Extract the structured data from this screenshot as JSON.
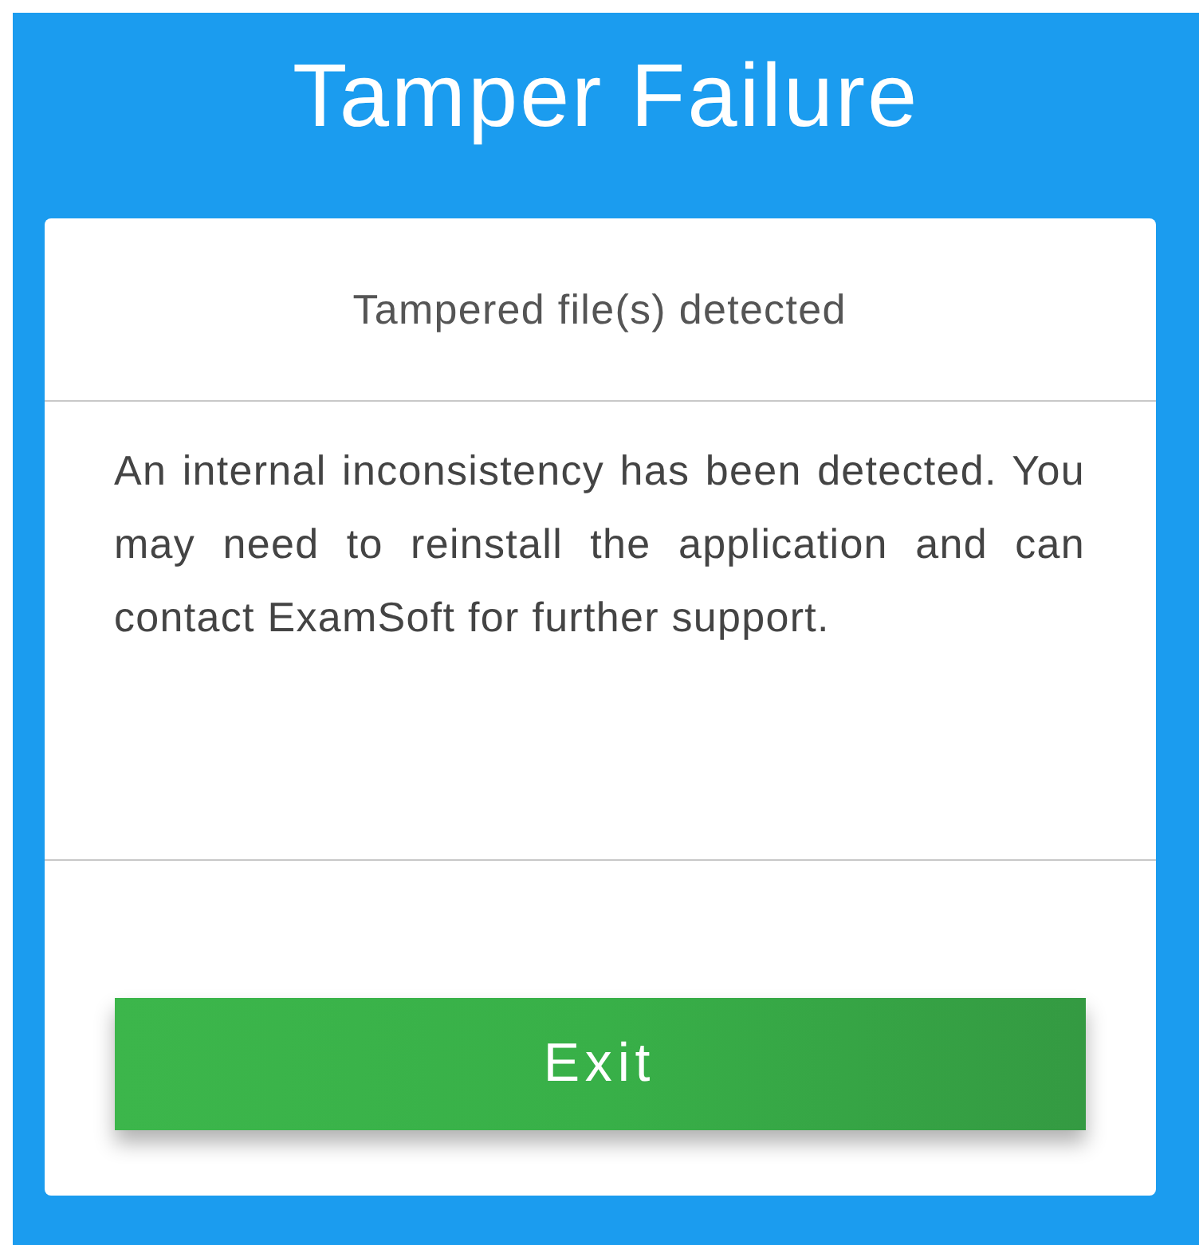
{
  "title": "Tamper Failure",
  "dialog": {
    "heading": "Tampered file(s) detected",
    "message": "An internal inconsistency has been detected. You may need to reinstall the application and can contact ExamSoft for further support.",
    "button": "Exit"
  }
}
